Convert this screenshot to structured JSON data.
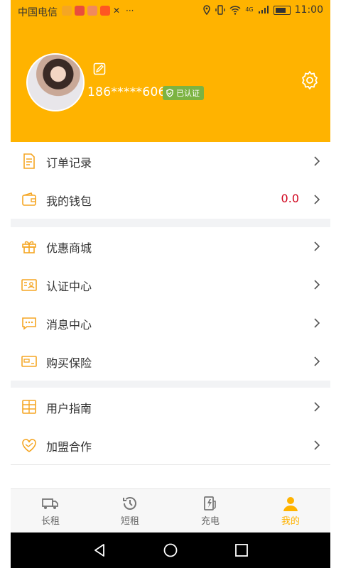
{
  "status_bar": {
    "carrier": "中国电信",
    "time": "11:00",
    "more": "···",
    "network": "4G"
  },
  "profile": {
    "phone": "186*****606",
    "verified_label": "已认证"
  },
  "menu_group1": [
    {
      "label": "订单记录",
      "icon": "document-icon"
    },
    {
      "label": "我的钱包",
      "icon": "wallet-icon",
      "value": "0.0"
    }
  ],
  "menu_group2": [
    {
      "label": "优惠商城",
      "icon": "gift-icon"
    },
    {
      "label": "认证中心",
      "icon": "id-card-icon"
    },
    {
      "label": "消息中心",
      "icon": "message-icon"
    },
    {
      "label": "购买保险",
      "icon": "insurance-icon"
    }
  ],
  "menu_group3": [
    {
      "label": "用户指南",
      "icon": "guide-icon"
    },
    {
      "label": "加盟合作",
      "icon": "handshake-icon"
    }
  ],
  "tabs": [
    {
      "label": "长租",
      "icon": "truck-icon"
    },
    {
      "label": "短租",
      "icon": "history-icon"
    },
    {
      "label": "充电",
      "icon": "charging-icon"
    },
    {
      "label": "我的",
      "icon": "user-icon",
      "active": true
    }
  ],
  "colors": {
    "accent": "#FFB300",
    "verified": "#7CB342",
    "wallet_value": "#D0021B"
  }
}
